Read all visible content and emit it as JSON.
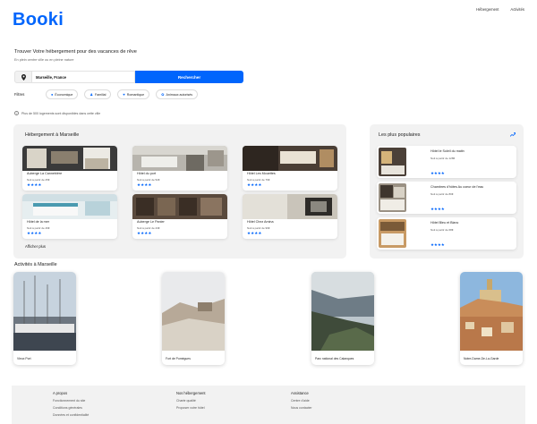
{
  "brand": {
    "logo": "Booki",
    "accent": "#0065FC"
  },
  "nav": {
    "items": [
      "Hébergement",
      "Activités"
    ]
  },
  "hero": {
    "title": "Trouver Votre hébergement pour des vacances de rêve",
    "subtitle": "En plein centre ville ou en pleine nature"
  },
  "search": {
    "icon": "location-pin-icon",
    "value": "Marseille, France",
    "button": "Rechercher"
  },
  "filters": {
    "label": "Filtres",
    "chips": [
      {
        "label": "Économique",
        "icon": "money-icon"
      },
      {
        "label": "Familial",
        "icon": "family-icon"
      },
      {
        "label": "Romantique",
        "icon": "heart-icon"
      },
      {
        "label": "Animaux autorisés",
        "icon": "paw-icon"
      }
    ]
  },
  "info": {
    "icon": "info-icon",
    "text": "Plus de 500 logements sont disponibles dans cette ville"
  },
  "hotels": {
    "title": "Hébergement à Marseille",
    "more": "Afficher plus",
    "items": [
      {
        "name": "Auberge La Cannebière",
        "price": "Nuit à partir de 25€",
        "rating": 4
      },
      {
        "name": "Hôtel du port",
        "price": "Nuit à partir de 52€",
        "rating": 4
      },
      {
        "name": "Hôtel Les Mouettes",
        "price": "Nuit à partir de 76€",
        "rating": 4
      },
      {
        "name": "Hôtel de la mer",
        "price": "Nuit à partir de 46€",
        "rating": 4
      },
      {
        "name": "Auberge Le Panier",
        "price": "Nuit à partir de 23€",
        "rating": 4
      },
      {
        "name": "Hôtel Chez Amina",
        "price": "Nuit à partir de 96€",
        "rating": 4
      }
    ]
  },
  "popular": {
    "title": "Les plus populaires",
    "icon": "trending-up-icon",
    "items": [
      {
        "name": "Hôtel le Soleil du matin",
        "price": "Nuit à partir de 128€",
        "rating": 4
      },
      {
        "name": "Chambres d'hôtes Au coeur de l'eau",
        "price": "Nuit à partir de 80€",
        "rating": 4
      },
      {
        "name": "Hôtel Bleu et Blanc",
        "price": "Nuit à partir de 68€",
        "rating": 4
      }
    ]
  },
  "activities": {
    "title": "Activités à Marseille",
    "items": [
      {
        "label": "Vieux Port"
      },
      {
        "label": "Fort de Pomègues"
      },
      {
        "label": "Parc national des Calanques"
      },
      {
        "label": "Notre-Dame-De-La-Garde"
      }
    ]
  },
  "footer": {
    "columns": [
      {
        "heading": "A propos",
        "links": [
          "Fonctionnement du site",
          "Conditions générales",
          "Données et confidentialité"
        ]
      },
      {
        "heading": "Nos hébergement",
        "links": [
          "Charte qualité",
          "Proposer votre hôtel"
        ]
      },
      {
        "heading": "Assistance",
        "links": [
          "Centre d'aide",
          "Nous contacter"
        ]
      }
    ]
  }
}
